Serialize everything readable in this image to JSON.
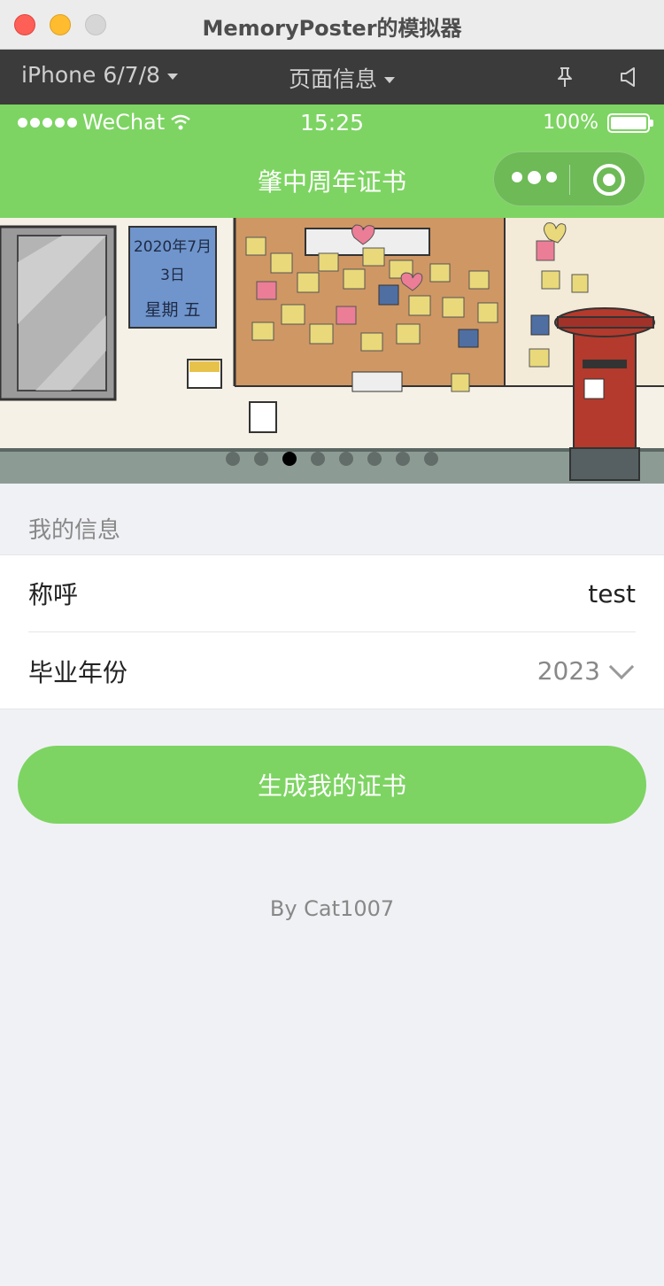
{
  "window": {
    "title": "MemoryPoster的模拟器"
  },
  "toolbar": {
    "device": "iPhone 6/7/8",
    "page_info": "页面信息"
  },
  "statusbar": {
    "carrier": "WeChat",
    "time": "15:25",
    "battery": "100%"
  },
  "navbar": {
    "title": "肇中周年证书"
  },
  "banner": {
    "slide_count": 8,
    "active_index": 2,
    "board_date": "2020年7月",
    "board_day": "3日",
    "board_week": "星期 五"
  },
  "form": {
    "section_title": "我的信息",
    "name_label": "称呼",
    "name_value": "test",
    "year_label": "毕业年份",
    "year_value": "2023"
  },
  "actions": {
    "generate_label": "生成我的证书"
  },
  "footer": {
    "credit": "By Cat1007"
  },
  "colors": {
    "accent": "#7dd462",
    "background": "#f0f1f5"
  }
}
